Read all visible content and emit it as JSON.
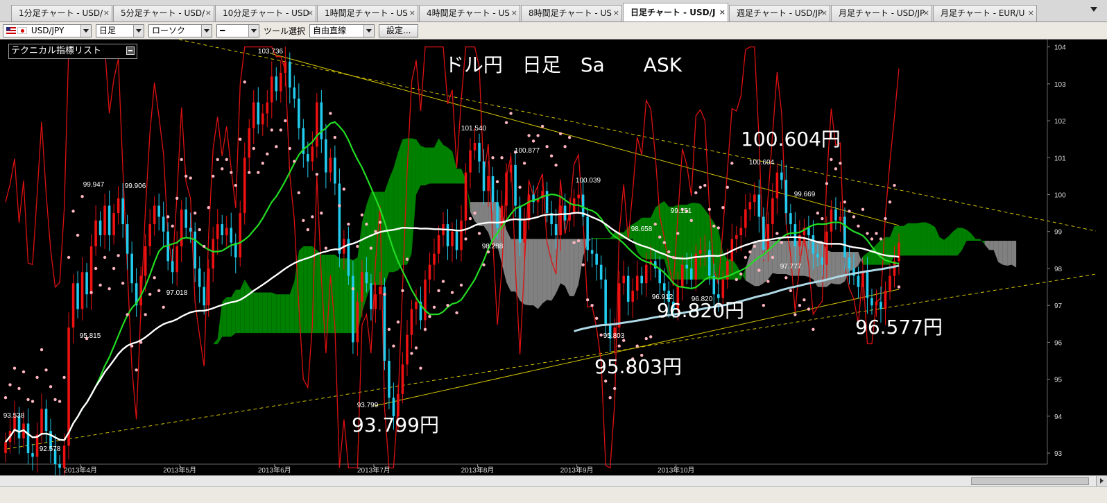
{
  "tabs": [
    {
      "label": "1分足チャート - USD/",
      "active": false
    },
    {
      "label": "5分足チャート - USD/",
      "active": false
    },
    {
      "label": "10分足チャート - USD",
      "active": false
    },
    {
      "label": "1時間足チャート - US",
      "active": false
    },
    {
      "label": "4時間足チャート - US",
      "active": false
    },
    {
      "label": "8時間足チャート - US",
      "active": false
    },
    {
      "label": "日足チャート - USD/J",
      "active": true
    },
    {
      "label": "週足チャート - USD/JP",
      "active": false
    },
    {
      "label": "月足チャート - USD/JP",
      "active": false
    },
    {
      "label": "月足チャート - EUR/U",
      "active": false
    }
  ],
  "tab_close_glyph": "×",
  "toolbar": {
    "pair": "USD/JPY",
    "timeframe": "日足",
    "chart_style": "ローソク",
    "line_style": "━",
    "tool_label": "ツール選択",
    "tool": "自由直線",
    "settings_button": "設定..."
  },
  "indicator_panel": {
    "label": "テクニカル指標リスト"
  },
  "chart_data": {
    "type": "candlestick",
    "title": "ドル円　日足　Sa　　ASK",
    "ylim": [
      92.4,
      104.2
    ],
    "y_ticks": [
      93,
      94,
      95,
      96,
      97,
      98,
      99,
      100,
      101,
      102,
      103,
      104
    ],
    "x_ticks": [
      "2013年4月",
      "2013年5月",
      "2013年6月",
      "2013年7月",
      "2013年8月",
      "2013年9月",
      "2013年10月"
    ],
    "closes": [
      93.3,
      93.6,
      94.0,
      93.4,
      93.8,
      93.0,
      92.9,
      93.5,
      94.2,
      93.6,
      93.1,
      92.7,
      92.6,
      93.2,
      96.4,
      97.6,
      96.9,
      97.9,
      97.3,
      98.6,
      99.3,
      98.9,
      99.7,
      98.9,
      99.5,
      99.9,
      99.2,
      98.4,
      97.6,
      97.0,
      97.8,
      98.6,
      99.2,
      99.7,
      99.4,
      99.0,
      98.2,
      97.9,
      98.6,
      99.6,
      99.1,
      99.0,
      98.0,
      97.5,
      97.0,
      98.0,
      98.8,
      99.2,
      98.9,
      99.1,
      98.7,
      98.3,
      99.5,
      101.0,
      101.8,
      102.5,
      101.9,
      102.2,
      102.5,
      103.2,
      102.8,
      103.3,
      103.6,
      102.9,
      102.6,
      101.8,
      101.1,
      100.9,
      101.3,
      102.5,
      101.5,
      100.6,
      101.0,
      100.3,
      98.4,
      98.8,
      97.8,
      96.0,
      97.1,
      97.9,
      97.6,
      96.9,
      97.3,
      97.5,
      95.5,
      94.5,
      94.0,
      94.6,
      95.4,
      96.2,
      96.9,
      97.1,
      96.6,
      97.7,
      98.1,
      98.4,
      98.9,
      99.2,
      98.6,
      99.0,
      98.5,
      99.3,
      100.6,
      101.2,
      101.4,
      100.9,
      100.1,
      100.5,
      99.8,
      99.1,
      99.7,
      100.6,
      100.8,
      99.7,
      98.7,
      99.3,
      100.0,
      99.8,
      99.9,
      100.1,
      99.5,
      99.2,
      98.9,
      99.7,
      99.3,
      99.5,
      99.9,
      100.0,
      99.4,
      98.5,
      98.4,
      98.1,
      97.7,
      96.5,
      96.1,
      96.4,
      97.6,
      97.8,
      97.1,
      97.4,
      97.8,
      97.6,
      98.1,
      98.2,
      98.0,
      97.6,
      97.4,
      97.1,
      96.9,
      97.5,
      98.1,
      98.0,
      97.7,
      98.4,
      98.5,
      98.5,
      97.8,
      97.3,
      97.2,
      97.7,
      98.2,
      98.8,
      98.9,
      99.1,
      99.6,
      99.8,
      100.0,
      99.4,
      98.5,
      99.2,
      99.9,
      100.6,
      100.4,
      99.5,
      99.2,
      98.6,
      98.9,
      99.1,
      98.9,
      98.4,
      98.3,
      98.1,
      99.0,
      99.6,
      99.3,
      99.4,
      98.3,
      98.0,
      97.8,
      97.5,
      97.9,
      97.2,
      97.0,
      97.1,
      96.9,
      97.4,
      97.8,
      98.2,
      98.7
    ],
    "price_labels": [
      {
        "text": "93.538"
      },
      {
        "text": "92.578"
      },
      {
        "text": "95.815"
      },
      {
        "text": "97.018"
      },
      {
        "text": "99.947"
      },
      {
        "text": "99.906"
      },
      {
        "text": "103.736"
      },
      {
        "text": "93.799"
      },
      {
        "text": "101.540"
      },
      {
        "text": "100.877"
      },
      {
        "text": "98.288"
      },
      {
        "text": "100.039"
      },
      {
        "text": "95.803"
      },
      {
        "text": "98.658"
      },
      {
        "text": "99.151"
      },
      {
        "text": "96.912"
      },
      {
        "text": "96.820"
      },
      {
        "text": "100.604"
      },
      {
        "text": "99.669"
      },
      {
        "text": "97.777"
      }
    ],
    "annotations": [
      {
        "text": "100.604円"
      },
      {
        "text": "96.820円"
      },
      {
        "text": "96.577円"
      },
      {
        "text": "95.803円"
      },
      {
        "text": "93.799円"
      }
    ],
    "colors": {
      "background": "#000000",
      "up": "#ee1111",
      "down": "#22ccee",
      "cloud_bull": "#008000",
      "cloud_bear": "#808080",
      "ma_short": "#22dd22",
      "ma_mid": "#ffffff",
      "ma_long": "#add8e6",
      "parabolic": "#ffb6c1",
      "oscillator": "#dd1111",
      "trendline": "#d4c400"
    }
  }
}
